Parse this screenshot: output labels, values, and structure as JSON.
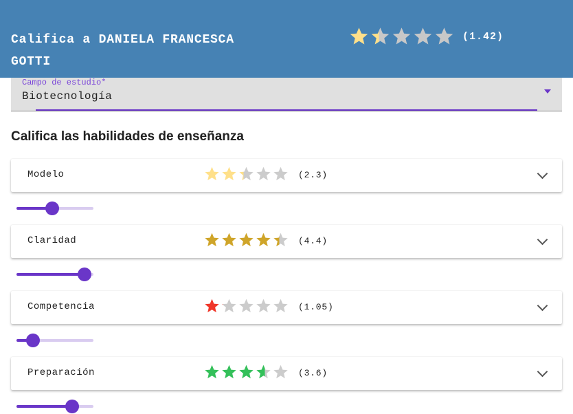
{
  "header": {
    "title": "Califica a DANIELA FRANCESCA GOTTI",
    "rating": 1.42,
    "score_text": "(1.42)",
    "star_color": "#ffe08a",
    "empty_star_color": "#c8c8c8"
  },
  "field": {
    "label": "Campo de estudio*",
    "value": "Biotecnología"
  },
  "section_title": "Califica las habilidades de enseñanza",
  "skills": [
    {
      "label": "Modelo",
      "rating": 2.3,
      "score_text": "(2.3)",
      "star_color": "#ffe08a",
      "slider_value": 0.46
    },
    {
      "label": "Claridad",
      "rating": 4.4,
      "score_text": "(4.4)",
      "star_color": "#cfa52a",
      "slider_value": 0.88
    },
    {
      "label": "Competencia",
      "rating": 1.05,
      "score_text": "(1.05)",
      "star_color": "#f0372a",
      "slider_value": 0.21
    },
    {
      "label": "Preparación",
      "rating": 3.6,
      "score_text": "(3.6)",
      "star_color": "#34c05a",
      "slider_value": 0.72
    }
  ],
  "empty_star_color": "#cccccc",
  "accent_color": "#6a36c8"
}
